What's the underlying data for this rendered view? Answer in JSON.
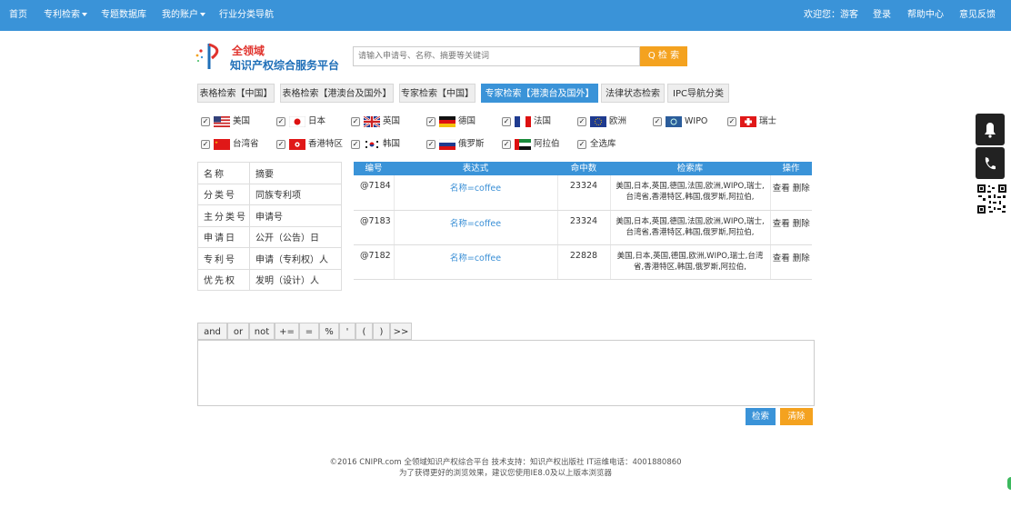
{
  "topnav": {
    "left": [
      {
        "label": "首页",
        "dropdown": false
      },
      {
        "label": "专利检索",
        "dropdown": true
      },
      {
        "label": "专题数据库",
        "dropdown": false
      },
      {
        "label": "我的账户",
        "dropdown": true
      },
      {
        "label": "行业分类导航",
        "dropdown": false
      }
    ],
    "welcome": "欢迎您：游客",
    "login": "登录",
    "help": "帮助中心",
    "feedback": "意见反馈",
    "bg_color": "#3a93d8"
  },
  "logo": {
    "line1": "全领域",
    "line2": "知识产权综合服务平台"
  },
  "search": {
    "placeholder": "请输入申请号、名称、摘要等关键词",
    "button_label": "Q 检 索",
    "button_color": "#f4a21f"
  },
  "tabs": [
    {
      "label": "表格检索【中国】",
      "active": false
    },
    {
      "label": "表格检索【港澳台及国外】",
      "active": false
    },
    {
      "label": "专家检索【中国】",
      "active": false
    },
    {
      "label": "专家检索【港澳台及国外】",
      "active": true
    },
    {
      "label": "法律状态检索",
      "active": false
    },
    {
      "label": "IPC导航分类",
      "active": false
    }
  ],
  "countries": [
    {
      "label": "美国",
      "checked": true,
      "flag": "us-flag"
    },
    {
      "label": "日本",
      "checked": true,
      "flag": "jp-flag"
    },
    {
      "label": "英国",
      "checked": true,
      "flag": "gb-flag"
    },
    {
      "label": "德国",
      "checked": true,
      "flag": "de-flag"
    },
    {
      "label": "法国",
      "checked": true,
      "flag": "fr-flag"
    },
    {
      "label": "欧洲",
      "checked": true,
      "flag": "eu-flag"
    },
    {
      "label": "WIPO",
      "checked": true,
      "flag": "wipo-flag"
    },
    {
      "label": "瑞士",
      "checked": true,
      "flag": "ch-flag"
    },
    {
      "label": "台湾省",
      "checked": true,
      "flag": "tw-flag"
    },
    {
      "label": "香港特区",
      "checked": true,
      "flag": "hk-flag"
    },
    {
      "label": "韩国",
      "checked": true,
      "flag": "kr-flag"
    },
    {
      "label": "俄罗斯",
      "checked": true,
      "flag": "ru-flag"
    },
    {
      "label": "阿拉伯",
      "checked": true,
      "flag": "ae-flag"
    },
    {
      "label": "全选库",
      "checked": true,
      "flag": ""
    }
  ],
  "fields": [
    [
      "名称",
      "摘要"
    ],
    [
      "分类号",
      "同族专利项"
    ],
    [
      "主分类号",
      "申请号"
    ],
    [
      "申请日",
      "公开（公告）日"
    ],
    [
      "专利号",
      "申请（专利权）人"
    ],
    [
      "优先权",
      "发明（设计）人"
    ]
  ],
  "results": {
    "headers": [
      "编号",
      "表达式",
      "命中数",
      "检索库",
      "操作"
    ],
    "rows": [
      {
        "id": "@7184",
        "expr": "名称=coffee",
        "hits": "23324",
        "db": "美国,日本,英国,德国,法国,欧洲,WIPO,瑞士,台湾省,香港特区,韩国,俄罗斯,阿拉伯,",
        "view": "查看",
        "del": "删除"
      },
      {
        "id": "@7183",
        "expr": "名称=coffee",
        "hits": "23324",
        "db": "美国,日本,英国,德国,法国,欧洲,WIPO,瑞士,台湾省,香港特区,韩国,俄罗斯,阿拉伯,",
        "view": "查看",
        "del": "删除"
      },
      {
        "id": "@7182",
        "expr": "名称=coffee",
        "hits": "22828",
        "db": "美国,日本,英国,德国,欧洲,WIPO,瑞士,台湾省,香港特区,韩国,俄罗斯,阿拉伯,",
        "view": "查看",
        "del": "删除"
      }
    ]
  },
  "operators": [
    "and",
    "or",
    "not",
    "+=",
    "=",
    "%",
    "'",
    "(",
    ")",
    ">>"
  ],
  "actions": {
    "search": "检索",
    "clear": "清除"
  },
  "footer": {
    "line1": "©2016 CNIPR.com  全领域知识产权综合平台 技术支持：知识产权出版社 IT运维电话：4001880860",
    "line2": "为了获得更好的浏览效果，建议您使用IE8.0及以上版本浏览器"
  }
}
